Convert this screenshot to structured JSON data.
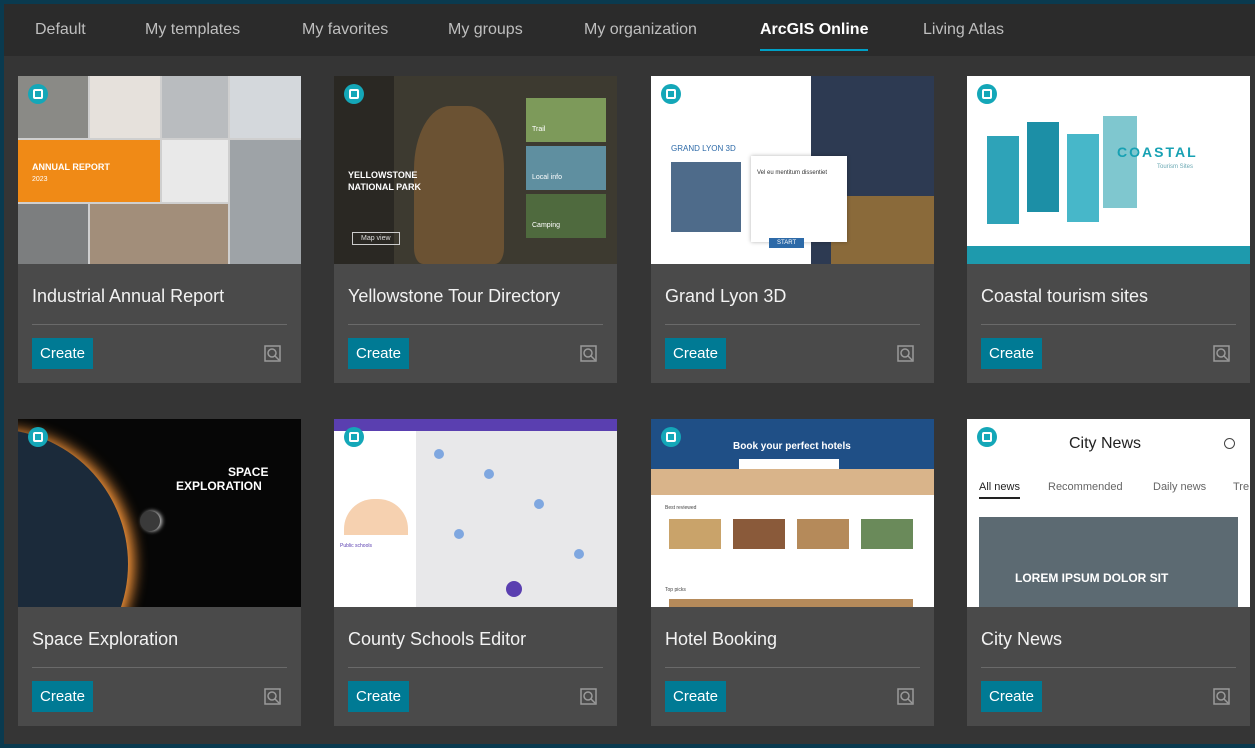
{
  "tabs": [
    {
      "label": "Default",
      "active": false
    },
    {
      "label": "My templates",
      "active": false
    },
    {
      "label": "My favorites",
      "active": false
    },
    {
      "label": "My groups",
      "active": false
    },
    {
      "label": "My organization",
      "active": false
    },
    {
      "label": "ArcGIS Online",
      "active": true
    },
    {
      "label": "Living Atlas",
      "active": false
    }
  ],
  "create_label": "Create",
  "accent_color": "#007a94",
  "cards": [
    {
      "title": "Industrial Annual Report",
      "thumb_text": [
        "ANNUAL REPORT",
        "2023"
      ]
    },
    {
      "title": "Yellowstone Tour Directory",
      "thumb_text": [
        "YELLOWSTONE",
        "NATIONAL PARK",
        "Map view",
        "Trail",
        "Local info",
        "Camping"
      ]
    },
    {
      "title": "Grand Lyon 3D",
      "thumb_text": [
        "GRAND LYON 3D",
        "Vel eu mentitum dissentiet",
        "START"
      ]
    },
    {
      "title": "Coastal tourism sites",
      "thumb_text": [
        "COASTAL",
        "Tourism Sites"
      ]
    },
    {
      "title": "Space Exploration",
      "thumb_text": [
        "SPACE",
        "EXPLORATION"
      ]
    },
    {
      "title": "County Schools Editor",
      "thumb_text": [
        "Public schools"
      ]
    },
    {
      "title": "Hotel Booking",
      "thumb_text": [
        "Book your perfect hotels",
        "Best reviewed",
        "Top picks"
      ]
    },
    {
      "title": "City News",
      "thumb_text": [
        "City News",
        "All news",
        "Recommended",
        "Daily news",
        "Tre",
        "LOREM IPSUM DOLOR SIT"
      ]
    }
  ]
}
